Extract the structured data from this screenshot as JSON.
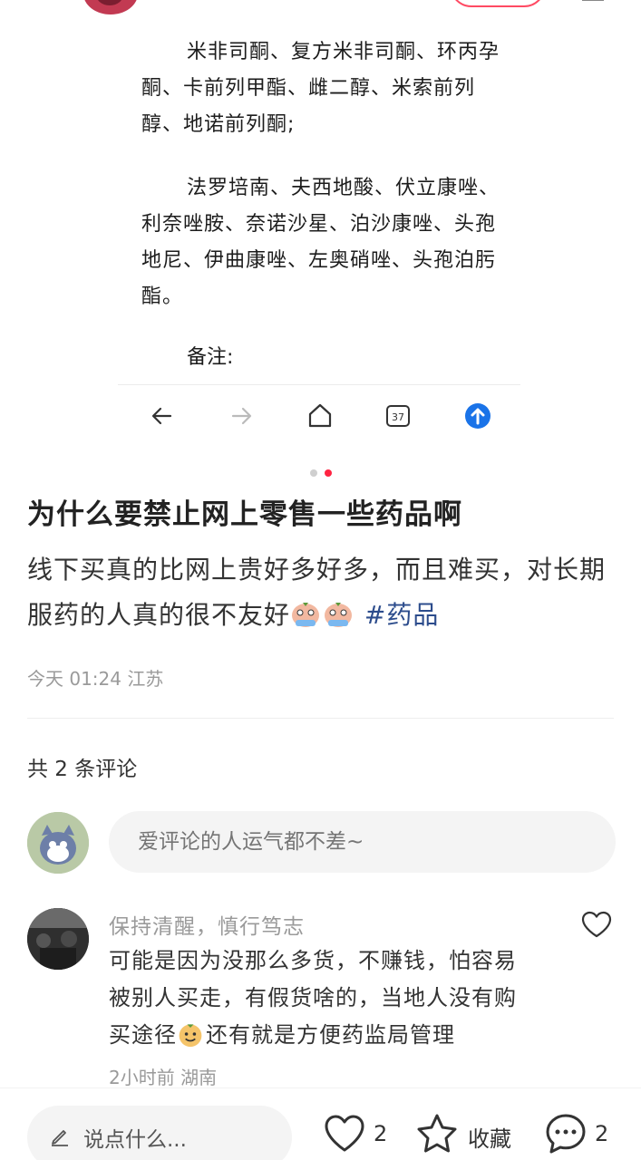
{
  "embed": {
    "paragraph1": "米非司酮、复方米非司酮、环丙孕酮、卡前列甲酯、雌二醇、米索前列醇、地诺前列酮;",
    "paragraph2": "法罗培南、夫西地酸、伏立康唑、利奈唑胺、奈诺沙星、泊沙康唑、头孢地尼、伊曲康唑、左奥硝唑、头孢泊肟酯。",
    "note": "备注:",
    "tab_count": "37"
  },
  "pager": {
    "total": 2,
    "active": 2
  },
  "post": {
    "title": "为什么要禁止网上零售一些药品啊",
    "body": "线下买真的比网上贵好多好多，而且难买，对长期服药的人真的很不友好",
    "hashtag": "#药品",
    "meta": "今天 01:24 江苏"
  },
  "comments_section": {
    "count_label": "共 2 条评论",
    "input_placeholder": "爱评论的人运气都不差~"
  },
  "comment": {
    "author": "保持清醒，慎行笃志",
    "text_part1": "可能是因为没那么多货，不赚钱，怕容易被别人买走，有假货啥的，当地人没有购买途径",
    "text_part2": "还有就是方便药监局管理",
    "meta": "2小时前 湖南"
  },
  "bottom_bar": {
    "say_placeholder": "说点什么...",
    "like_count": "2",
    "collect_label": "收藏",
    "comment_count": "2"
  },
  "colors": {
    "accent": "#ff2442",
    "hashtag": "#2c4c8c",
    "nav_blue": "#1a73e8"
  }
}
